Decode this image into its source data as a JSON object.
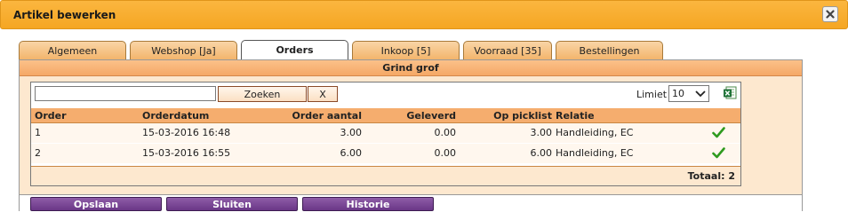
{
  "window": {
    "title": "Artikel bewerken"
  },
  "tabs": [
    {
      "label": "Algemeen",
      "active": false
    },
    {
      "label": "Webshop [Ja]",
      "active": false
    },
    {
      "label": "Orders",
      "active": true
    },
    {
      "label": "Inkoop [5]",
      "active": false
    },
    {
      "label": "Voorraad [35]",
      "active": false
    },
    {
      "label": "Bestellingen",
      "active": false
    }
  ],
  "section": {
    "title": "Grind grof"
  },
  "search": {
    "value": "",
    "search_label": "Zoeken",
    "clear_label": "X"
  },
  "limit": {
    "label": "Limiet",
    "value": "10"
  },
  "grid": {
    "columns": [
      "Order",
      "Orderdatum",
      "Order aantal",
      "Geleverd",
      "Op picklist",
      "Relatie"
    ],
    "rows": [
      {
        "order": "1",
        "date": "15-03-2016 16:48",
        "qty": "3.00",
        "delivered": "0.00",
        "picklist": "3.00",
        "relation": "Handleiding, EC",
        "status_icon": "checkmark-icon"
      },
      {
        "order": "2",
        "date": "15-03-2016 16:55",
        "qty": "6.00",
        "delivered": "0.00",
        "picklist": "6.00",
        "relation": "Handleiding, EC",
        "status_icon": "checkmark-icon"
      }
    ],
    "total": "Totaal: 2"
  },
  "actions": {
    "save": "Opslaan",
    "close": "Sluiten",
    "history": "Historie"
  },
  "colors": {
    "title_bar": "#f5a623",
    "header": "#f5ad6e",
    "content_bg": "#fde8cf",
    "button": "#6a3787",
    "check": "#2e9a1e"
  }
}
